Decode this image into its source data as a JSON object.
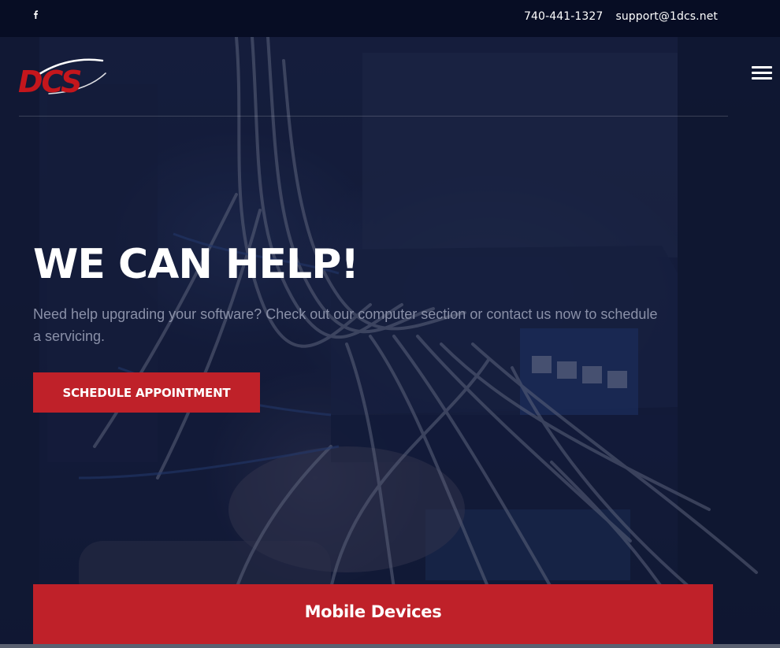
{
  "topbar": {
    "social": [
      {
        "icon": "facebook-icon"
      }
    ],
    "phone": "740-441-1327",
    "email": "support@1dcs.net"
  },
  "header": {
    "logo_text": "DCS",
    "menu_icon": "hamburger-menu-icon"
  },
  "hero": {
    "title": "WE CAN HELP!",
    "subtitle": "Need help upgrading your software? Check out our computer section or contact us now to schedule a servicing.",
    "cta_label": "SCHEDULE APPOINTMENT"
  },
  "services": [
    {
      "title": "Mobile Devices"
    }
  ],
  "colors": {
    "brand_red": "#bf2129",
    "topbar_bg": "#070d24",
    "hero_overlay": "#0e1634"
  }
}
